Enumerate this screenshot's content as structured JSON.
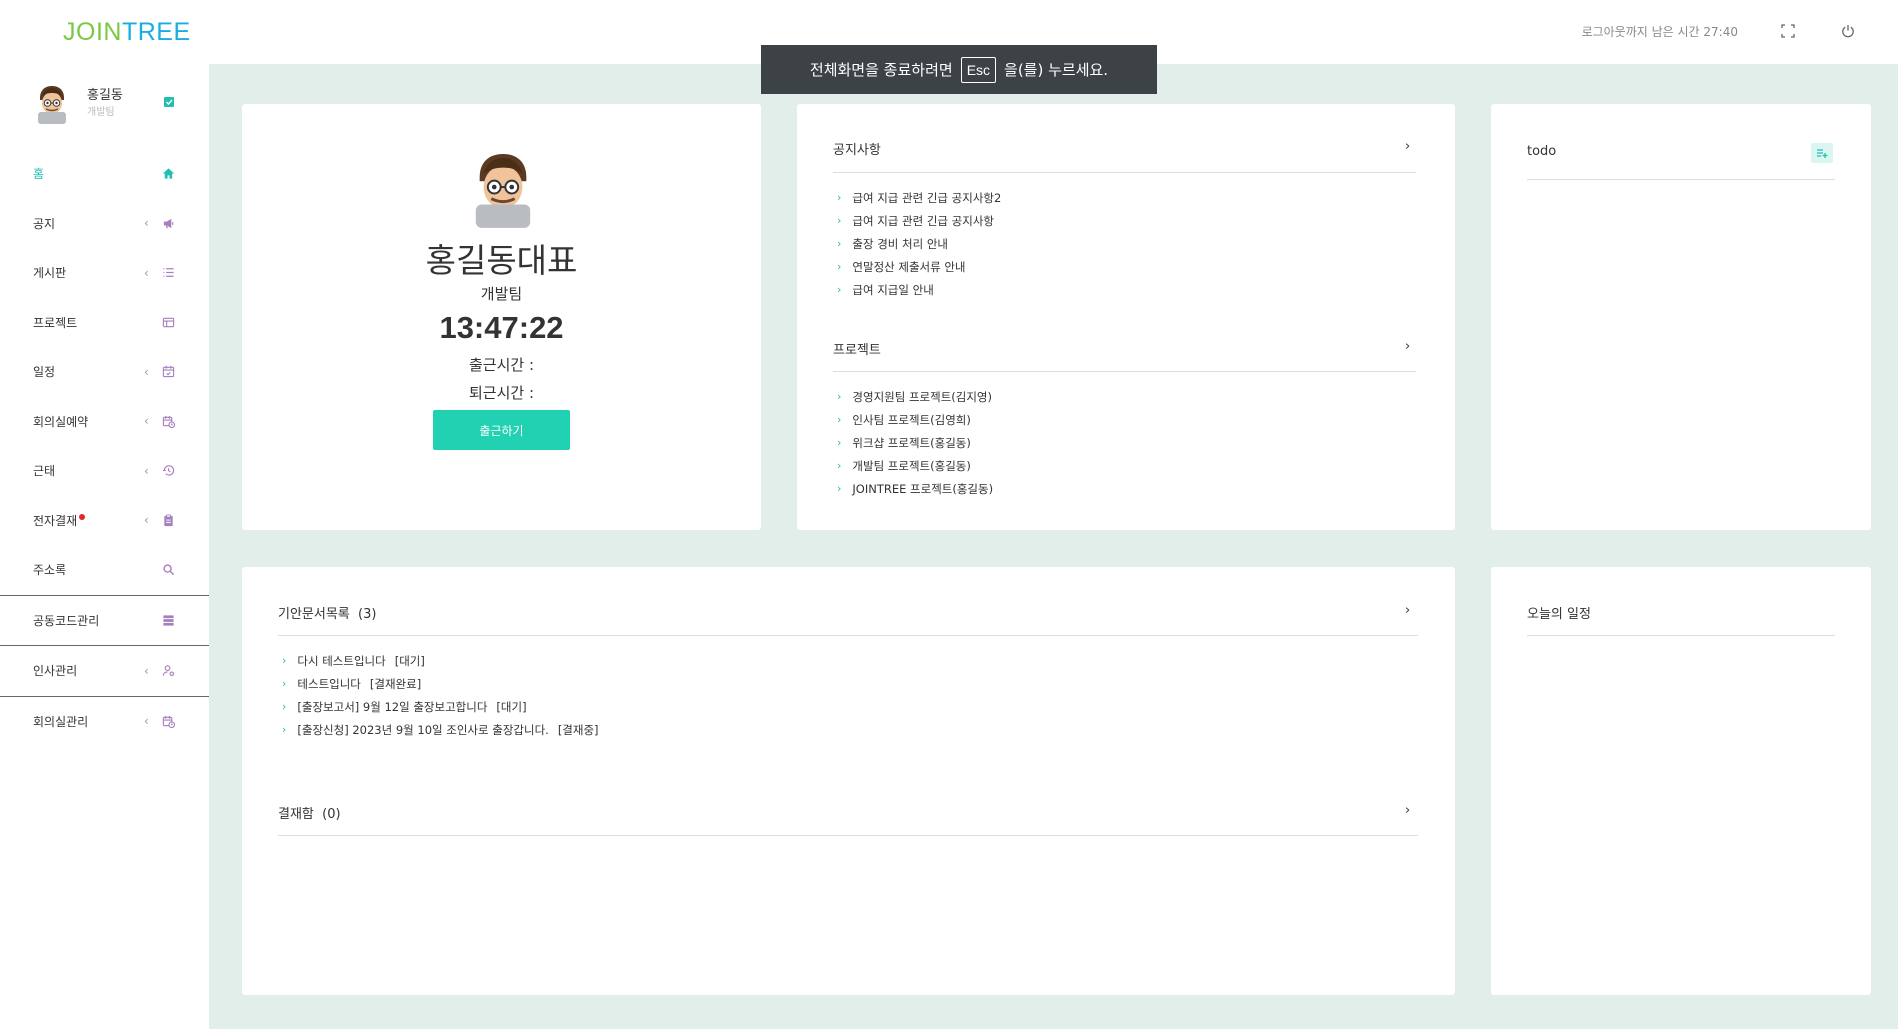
{
  "header": {
    "logo_part1": "JOIN",
    "logo_part2": "TREE",
    "logout_timer": "로그아웃까지 남은 시간 27:40",
    "fullscreen_icon": "fullscreen-icon",
    "power_icon": "power-icon"
  },
  "fullscreen_toast": {
    "before": "전체화면을 종료하려면",
    "key": "Esc",
    "after": "을(를) 누르세요."
  },
  "profile": {
    "name": "홍길동",
    "team": "개발팀"
  },
  "sidebar": {
    "items": [
      {
        "label": "홈",
        "icon": "home-icon"
      },
      {
        "label": "공지",
        "icon": "megaphone-icon"
      },
      {
        "label": "게시판",
        "icon": "list-icon"
      },
      {
        "label": "프로젝트",
        "icon": "project-icon"
      },
      {
        "label": "일정",
        "icon": "calendar-icon"
      },
      {
        "label": "회의실예약",
        "icon": "calendar-clock-icon"
      },
      {
        "label": "근태",
        "icon": "history-icon"
      },
      {
        "label": "전자결재",
        "icon": "clipboard-icon"
      },
      {
        "label": "주소록",
        "icon": "search-icon"
      },
      {
        "label": "공동코드관리",
        "icon": "database-icon"
      },
      {
        "label": "인사관리",
        "icon": "user-settings-icon"
      },
      {
        "label": "회의실관리",
        "icon": "calendar-clock-icon"
      }
    ]
  },
  "main_profile": {
    "name": "홍길동대표",
    "team": "개발팀",
    "clock": "13:47:22",
    "checkin_label": "출근시간 :",
    "checkout_label": "퇴근시간 :",
    "checkin_button": "출근하기"
  },
  "notice": {
    "title": "공지사항",
    "items": [
      "급여 지급 관련 긴급 공지사항2",
      "급여 지급 관련 긴급 공지사항",
      "출장 경비 처리 안내",
      "연말정산 제출서류 안내",
      "급여 지급일 안내"
    ]
  },
  "projects": {
    "title": "프로젝트",
    "items": [
      "경영지원팀 프로젝트(김지영)",
      "인사팀 프로젝트(김영희)",
      "위크샵 프로젝트(홍길동)",
      "개발팀 프로젝트(홍길동)",
      "JOINTREE 프로젝트(홍길동)"
    ]
  },
  "todo": {
    "title": "todo",
    "add_icon": "playlist-add-icon"
  },
  "drafts": {
    "title": "기안문서목록",
    "count": "(3)",
    "items": [
      {
        "text": "다시 테스트입니다",
        "status": "[대기]"
      },
      {
        "text": "테스트입니다",
        "status": "[결재완료]"
      },
      {
        "text": "[출장보고서] 9월 12일 출장보고합니다",
        "status": "[대기]"
      },
      {
        "text": "[출장신청] 2023년 9월 10일 조인사로 출장갑니다.",
        "status": "[결재중]"
      }
    ]
  },
  "approvals": {
    "title": "결재함",
    "count": "(0)"
  },
  "schedule": {
    "title": "오늘의 일정"
  },
  "colors": {
    "accent": "#21bfb0",
    "button": "#21d1b2",
    "main_bg": "#e2eeea",
    "menu_icon": "#a67fbf",
    "logo_green": "#7ac943",
    "logo_blue": "#1aaee0"
  }
}
